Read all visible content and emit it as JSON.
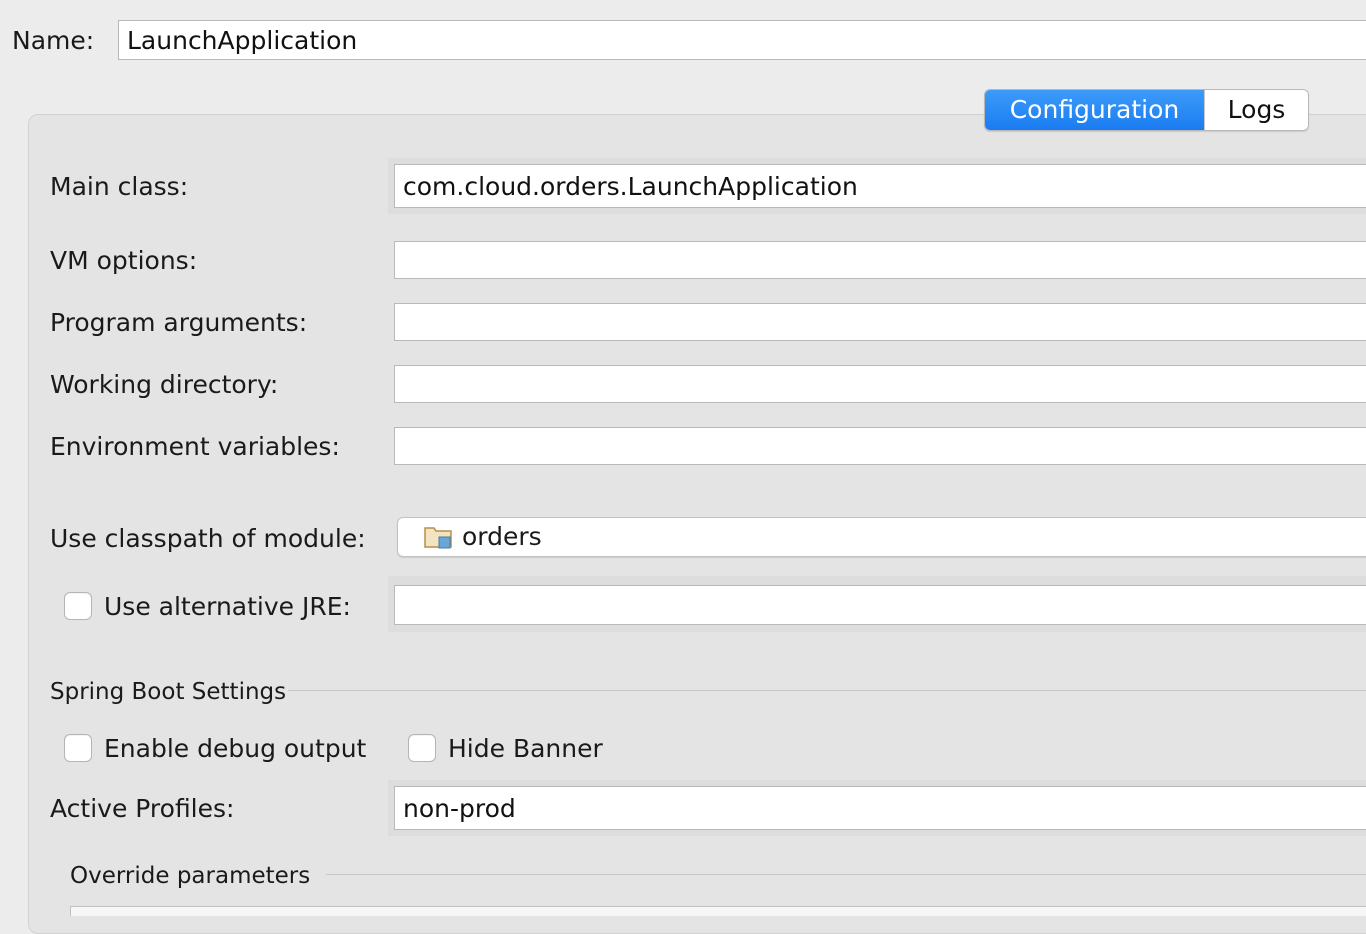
{
  "name_row": {
    "label": "Name:",
    "value": "LaunchApplication"
  },
  "tabs": [
    {
      "label": "Configuration",
      "active": true
    },
    {
      "label": "Logs",
      "active": false
    }
  ],
  "form": {
    "main_class": {
      "label": "Main class:",
      "value": "com.cloud.orders.LaunchApplication"
    },
    "vm_options": {
      "label": "VM options:",
      "value": ""
    },
    "program_arguments": {
      "label": "Program arguments:",
      "value": ""
    },
    "working_directory": {
      "label": "Working directory:",
      "value": ""
    },
    "environment_variables": {
      "label": "Environment variables:",
      "value": ""
    },
    "classpath_module": {
      "label": "Use classpath of module:",
      "value": "orders",
      "icon": "module-folder-icon"
    },
    "alternative_jre": {
      "label": "Use alternative JRE:",
      "checked": false,
      "value": ""
    }
  },
  "spring_boot": {
    "section_title": "Spring Boot Settings",
    "enable_debug": {
      "label": "Enable debug output",
      "checked": false
    },
    "hide_banner": {
      "label": "Hide Banner",
      "checked": false
    },
    "active_profiles": {
      "label": "Active Profiles:",
      "value": "non-prod"
    }
  },
  "override": {
    "section_title": "Override parameters"
  },
  "colors": {
    "window_bg": "#ececec",
    "panel_bg": "#e4e4e4",
    "accent": "#1a7cf2",
    "module_icon": "#c9a86a"
  }
}
